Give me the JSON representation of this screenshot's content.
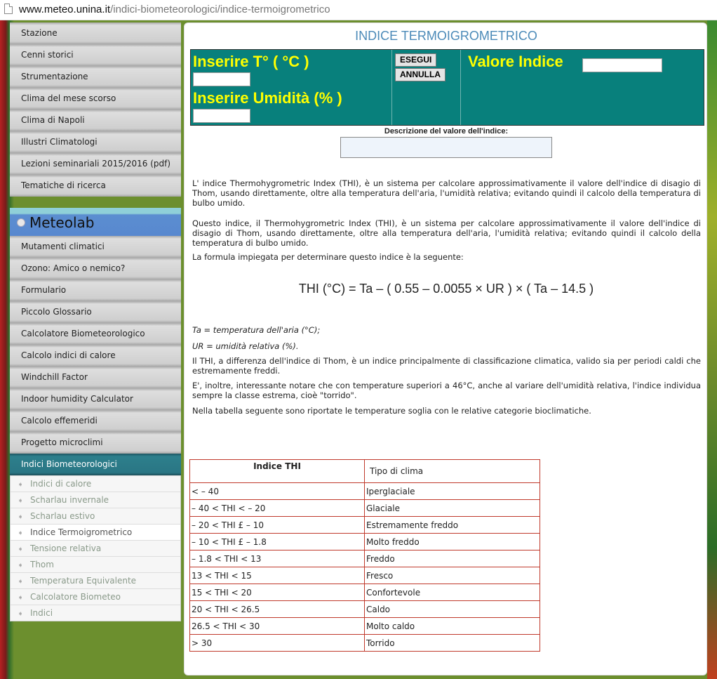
{
  "browser": {
    "url_host": "www.meteo.unina.it",
    "url_path": "/indici-biometeorologici/indice-termoigrometrico"
  },
  "sidebar": {
    "items": [
      "Stazione",
      "Cenni storici",
      "Strumentazione",
      "Clima del mese scorso",
      "Clima di Napoli",
      "Illustri Climatologi",
      "Lezioni seminariali 2015/2016 (pdf)",
      "Tematiche di ricerca"
    ],
    "section_title": "Meteolab",
    "meteolab_items": [
      "Mutamenti climatici",
      "Ozono: Amico o nemico?",
      "Formulario",
      "Piccolo Glossario",
      "Calcolatore Biometeorologico",
      "Calcolo indici di calore",
      "Windchill Factor",
      "Indoor humidity Calculator",
      "Calcolo effemeridi",
      "Progetto microclimi"
    ],
    "active_item": "Indici Biometeorologici",
    "subitems": [
      "Indici di calore",
      "Scharlau invernale",
      "Scharlau estivo",
      "Indice Termoigrometrico",
      "Tensione relativa",
      "Thom",
      "Temperatura Equivalente",
      "Calcolatore Biometeo",
      "Indici"
    ]
  },
  "main": {
    "title": "INDICE TERMOIGROMETRICO",
    "temp_label": "Inserire T° ( °C )",
    "humidity_label": "Inserire Umidità (% )",
    "run_button": "ESEGUI",
    "reset_button": "ANNULLA",
    "result_label": "Valore Indice",
    "description_label": "Descrizione del valore dell'indice:",
    "para1": "L' indice Thermohygrometric Index (THI), è un sistema per calcolare approssimativamente il valore dell'indice di disagio di Thom, usando direttamente, oltre alla temperatura dell'aria, l'umidità relativa; evitando quindi il calcolo della temperatura di bulbo umido.",
    "para2": "Questo indice, il Thermohygrometric Index (THI), è un sistema per calcolare approssimativamente il valore dell'indice di disagio di Thom, usando direttamente, oltre alla temperatura dell'aria, l'umidità relativa; evitando quindi il calcolo della temperatura di bulbo umido.",
    "para3": "La formula impiegata per determinare questo indice è la seguente:",
    "formula": "THI (°C) = Ta – ( 0.55 – 0.0055 × UR ) × ( Ta – 14.5 )",
    "def_ta": "Ta = temperatura dell'aria (°C);",
    "def_ur": "UR = umidità relativa (%).",
    "para4": "Il THI, a differenza dell'indice di Thom, è un indice principalmente di classificazione climatica, valido sia per periodi caldi che estremamente freddi.",
    "para5": "E', inoltre, interessante notare che con temperature superiori a 46°C, anche al variare dell'umidità relativa, l'indice individua sempre la classe estrema, cioè \"torrido\".",
    "para6": "Nella tabella seguente sono riportate le temperature soglia con le relative categorie bioclimatiche."
  },
  "table": {
    "headers": [
      "Indice THI",
      "Tipo di clima"
    ],
    "rows": [
      [
        "< – 40",
        "Iperglaciale"
      ],
      [
        "– 40 < THI < – 20",
        "Glaciale"
      ],
      [
        "– 20 < THI £ – 10",
        "Estremamente freddo"
      ],
      [
        "– 10 < THI £ – 1.8",
        "Molto freddo"
      ],
      [
        "– 1.8 < THI <  13",
        "Freddo"
      ],
      [
        "13 < THI <  15",
        "Fresco"
      ],
      [
        "15 < THI <  20",
        "Confortevole"
      ],
      [
        "20 < THI <  26.5",
        "Caldo"
      ],
      [
        "26.5 < THI <  30",
        "Molto caldo"
      ],
      [
        "> 30",
        "Torrido"
      ]
    ]
  },
  "colors": {
    "accent_title": "#4b8ab8",
    "calc_bg": "#08807c",
    "calc_label": "#ffff00",
    "table_border": "#c0392b",
    "active_menu": "#2a7684"
  }
}
